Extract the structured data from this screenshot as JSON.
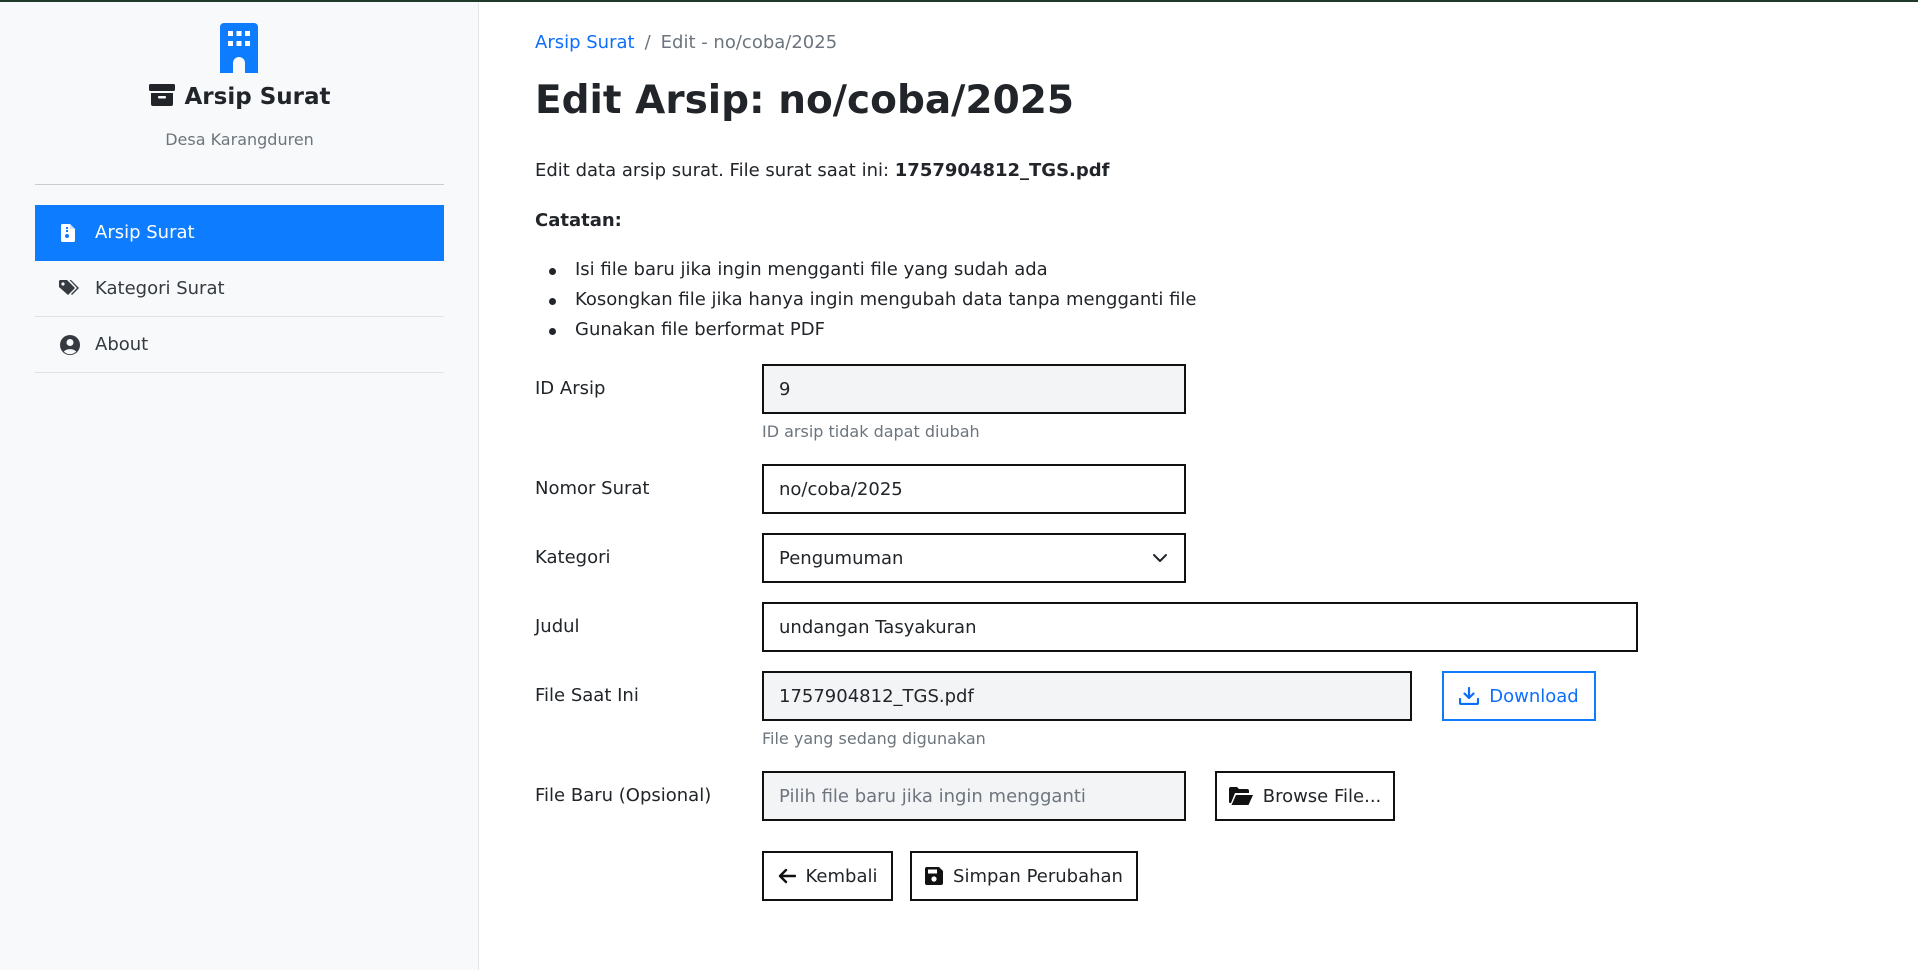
{
  "brand": {
    "title": "Arsip Surat",
    "subtitle": "Desa Karangduren",
    "logo_icon": "building-icon",
    "title_icon": "archive-box-icon",
    "accent": "#0d7cff"
  },
  "sidebar": {
    "items": [
      {
        "label": "Arsip Surat",
        "icon": "file-icon",
        "active": true
      },
      {
        "label": "Kategori Surat",
        "icon": "tags-icon",
        "active": false
      },
      {
        "label": "About",
        "icon": "user-circle-icon",
        "active": false
      }
    ]
  },
  "breadcrumb": {
    "parent": "Arsip Surat",
    "separator": "/",
    "current": "Edit - no/coba/2025"
  },
  "page": {
    "title": "Edit Arsip: no/coba/2025",
    "description_prefix": "Edit data arsip surat. File surat saat ini: ",
    "current_file": "1757904812_TGS.pdf",
    "note_title": "Catatan:",
    "notes": [
      "Isi file baru jika ingin mengganti file yang sudah ada",
      "Kosongkan file jika hanya ingin mengubah data tanpa mengganti file",
      "Gunakan file berformat PDF"
    ]
  },
  "form": {
    "id_arsip": {
      "label": "ID Arsip",
      "value": "9",
      "help": "ID arsip tidak dapat diubah"
    },
    "nomor_surat": {
      "label": "Nomor Surat",
      "value": "no/coba/2025"
    },
    "kategori": {
      "label": "Kategori",
      "value": "Pengumuman"
    },
    "judul": {
      "label": "Judul",
      "value": "undangan Tasyakuran"
    },
    "file_saat_ini": {
      "label": "File Saat Ini",
      "value": "1757904812_TGS.pdf",
      "help": "File yang sedang digunakan",
      "download_label": "Download"
    },
    "file_baru": {
      "label": "File Baru (Opsional)",
      "placeholder": "Pilih file baru jika ingin mengganti",
      "browse_label": "Browse File..."
    },
    "back_label": "Kembali",
    "save_label": "Simpan Perubahan"
  }
}
